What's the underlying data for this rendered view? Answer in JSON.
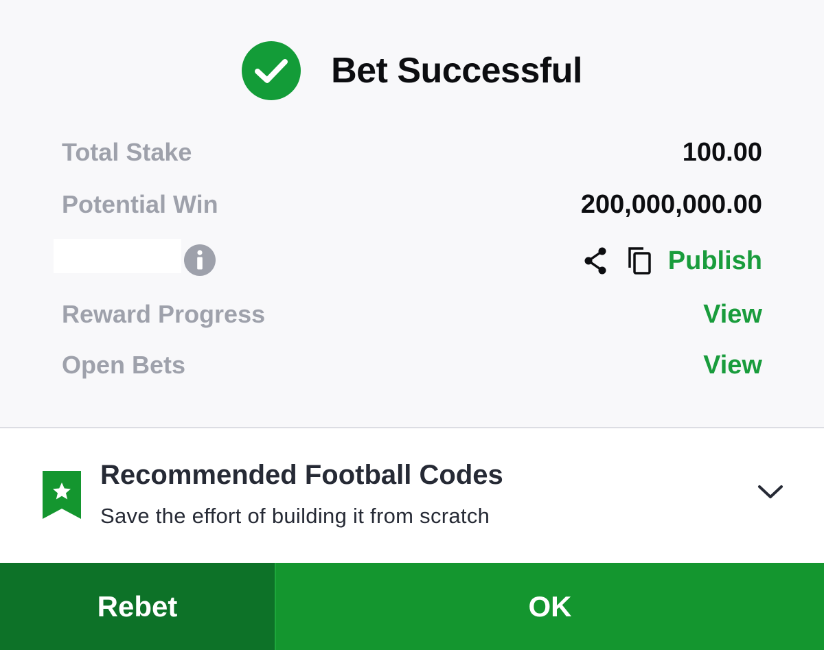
{
  "header": {
    "title": "Bet Successful",
    "icon": "check-circle-icon"
  },
  "summary": {
    "total_stake_label": "Total Stake",
    "total_stake_value": "100.00",
    "potential_win_label": "Potential Win",
    "potential_win_value": "200,000,000.00",
    "booking_row": {
      "info_icon": "info-icon",
      "share_icon": "share-icon",
      "copy_icon": "copy-icon",
      "publish_label": "Publish"
    },
    "reward_progress_label": "Reward Progress",
    "reward_progress_link": "View",
    "open_bets_label": "Open Bets",
    "open_bets_link": "View"
  },
  "recommendation": {
    "icon": "bookmark-star-icon",
    "title": "Recommended Football Codes",
    "subtitle": "Save the effort of building it from scratch",
    "expand_icon": "chevron-down-icon"
  },
  "footer": {
    "rebet_label": "Rebet",
    "ok_label": "OK"
  },
  "colors": {
    "brand_green": "#14962f",
    "dark_green": "#0d7228",
    "link_green": "#199c3c",
    "muted_label": "#9ea1ab"
  }
}
